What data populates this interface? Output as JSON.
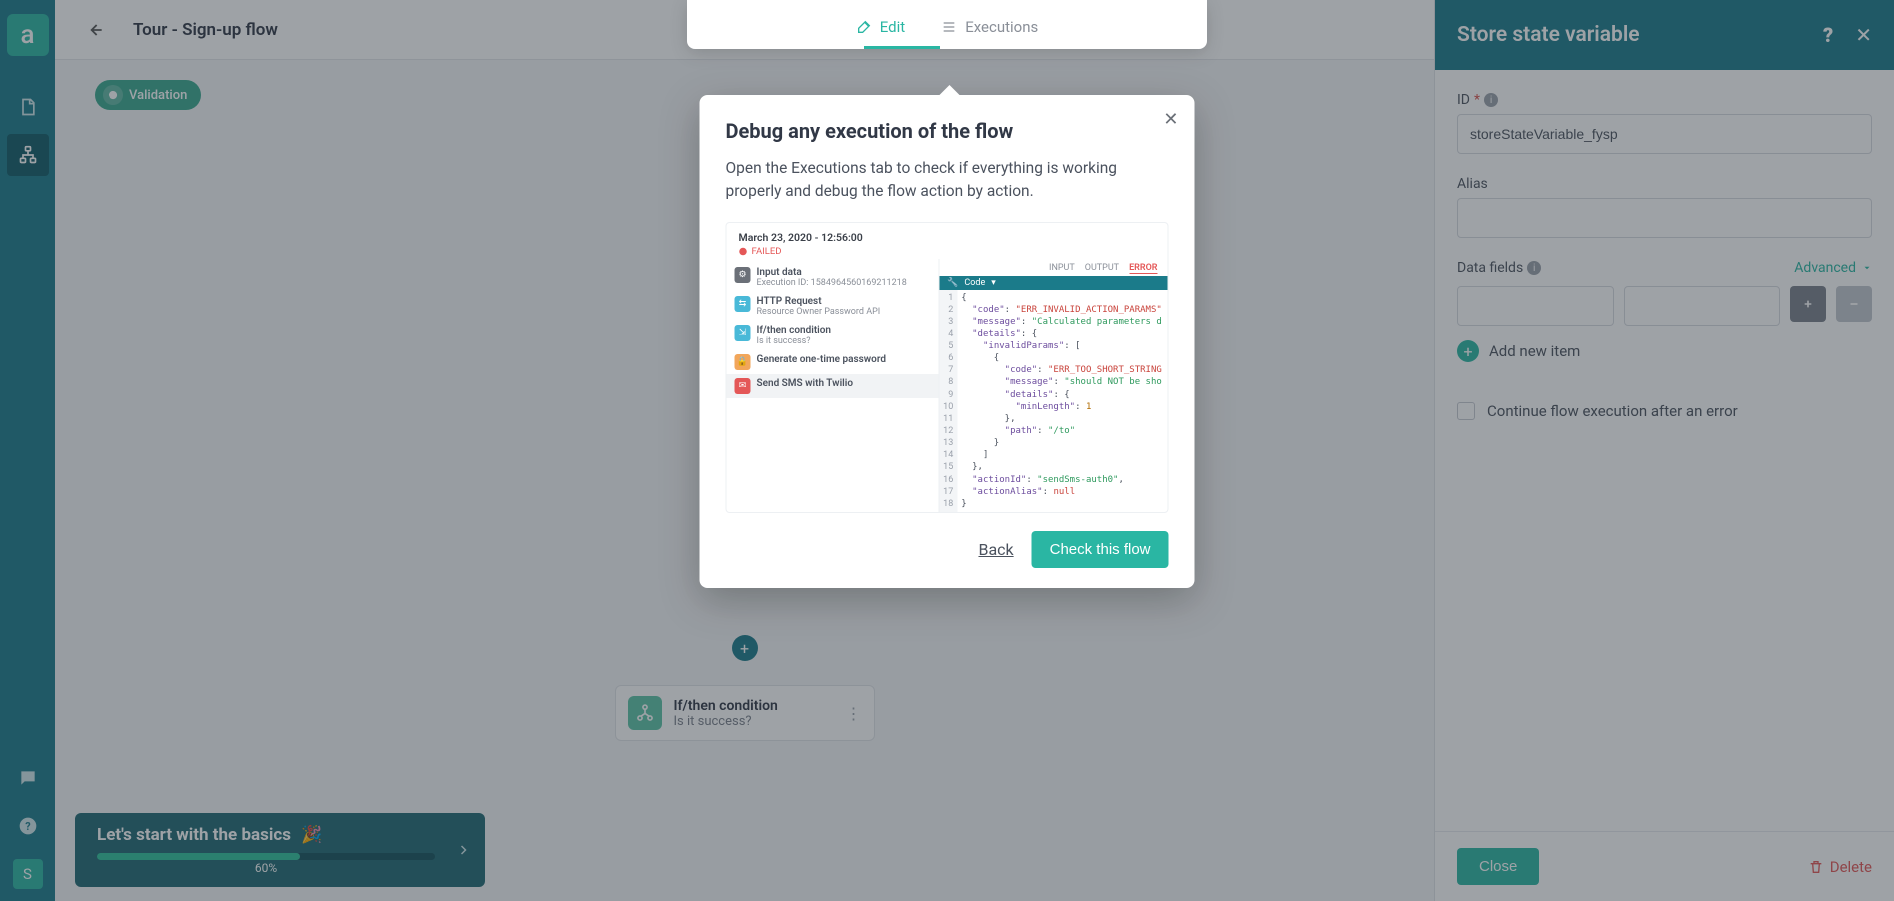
{
  "header": {
    "title": "Tour - Sign-up flow"
  },
  "sidebar": {
    "logo": "a",
    "user": "S"
  },
  "tabs": {
    "edit": "Edit",
    "executions": "Executions"
  },
  "canvas": {
    "validation_chip": "Validation",
    "flow_node": {
      "title": "If/then condition",
      "subtitle": "Is it success?"
    }
  },
  "onboarding": {
    "title": "Let's start with the basics",
    "percent_label": "60%",
    "percent": 60
  },
  "tour": {
    "title": "Debug any execution of the flow",
    "body": "Open the Executions tab to check if everything is working properly and debug the flow action by action.",
    "back": "Back",
    "cta": "Check this flow"
  },
  "exec_preview": {
    "timestamp": "March 23, 2020 - 12:56:00",
    "status": "FAILED",
    "rows": [
      {
        "icon_color": "#6b7078",
        "title": "Input data",
        "sub": "Execution ID: 1584964560169211218"
      },
      {
        "icon_color": "#49b9d8",
        "title": "HTTP Request",
        "sub": "Resource Owner Password API"
      },
      {
        "icon_color": "#49b9d8",
        "title": "If/then condition",
        "sub": "Is it success?"
      },
      {
        "icon_color": "#f2a65a",
        "title": "Generate one-time password",
        "sub": ""
      },
      {
        "icon_color": "#e45757",
        "title": "Send SMS with Twilio",
        "sub": ""
      }
    ],
    "right_tabs": [
      "INPUT",
      "OUTPUT",
      "ERROR"
    ],
    "codebar": "Code"
  },
  "panel": {
    "title": "Store state variable",
    "id_label": "ID",
    "id_value": "storeStateVariable_fysp",
    "alias_label": "Alias",
    "alias_value": "",
    "datafields_label": "Data fields",
    "advanced_label": "Advanced",
    "add_item": "Add new item",
    "continue_label": "Continue flow execution after an error",
    "close": "Close",
    "delete": "Delete"
  }
}
